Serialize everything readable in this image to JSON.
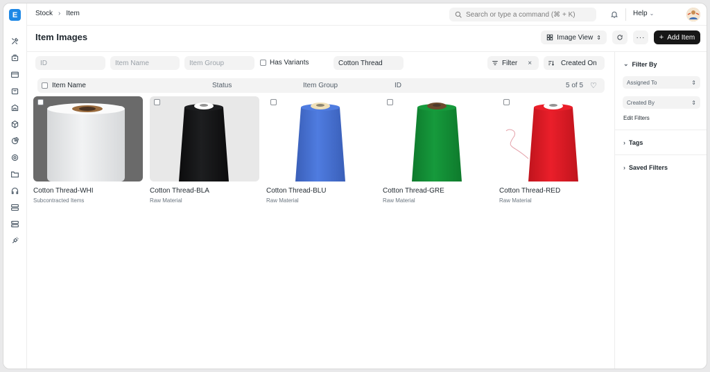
{
  "app": {
    "logo_letter": "E"
  },
  "breadcrumbs": [
    "Stock",
    "Item"
  ],
  "search": {
    "placeholder": "Search or type a command (⌘ + K)"
  },
  "topbar": {
    "help_label": "Help"
  },
  "page": {
    "title": "Item Images"
  },
  "toolbar": {
    "view_label": "Image View",
    "add_label": "Add Item"
  },
  "filters": {
    "id_placeholder": "ID",
    "item_name_placeholder": "Item Name",
    "item_group_placeholder": "Item Group",
    "has_variants_label": "Has Variants",
    "item_value": "Cotton Thread",
    "filter_label": "Filter",
    "sort_label": "Created On"
  },
  "list_header": {
    "col_item_name": "Item Name",
    "col_status": "Status",
    "col_item_group": "Item Group",
    "col_id": "ID",
    "count": "5 of 5"
  },
  "items": [
    {
      "title": "Cotton Thread-WHI",
      "group": "Subcontracted Items",
      "color": "#f2f3f4",
      "shade": "#d6d8da",
      "bg": "#6a6a6a"
    },
    {
      "title": "Cotton Thread-BLA",
      "group": "Raw Material",
      "color": "#1d1e20",
      "shade": "#0c0c0d",
      "bg": "#e8e8e8"
    },
    {
      "title": "Cotton Thread-BLU",
      "group": "Raw Material",
      "color": "#4f7ce0",
      "shade": "#3a5fb8",
      "bg": "#ffffff"
    },
    {
      "title": "Cotton Thread-GRE",
      "group": "Raw Material",
      "color": "#169a3c",
      "shade": "#0e7a2c",
      "bg": "#ffffff"
    },
    {
      "title": "Cotton Thread-RED",
      "group": "Raw Material",
      "color": "#ea1f2a",
      "shade": "#c0141d",
      "bg": "#ffffff"
    }
  ],
  "right_panel": {
    "filter_by": "Filter By",
    "assigned_to": "Assigned To",
    "created_by": "Created By",
    "edit_filters": "Edit Filters",
    "tags": "Tags",
    "saved_filters": "Saved Filters"
  },
  "sidebar_icons": [
    "tools-icon",
    "box-icon",
    "card-icon",
    "bag-icon",
    "building-icon",
    "cube-icon",
    "pie-icon",
    "target-icon",
    "folder-icon",
    "headset-icon",
    "server-icon",
    "database-icon",
    "plug-icon"
  ]
}
